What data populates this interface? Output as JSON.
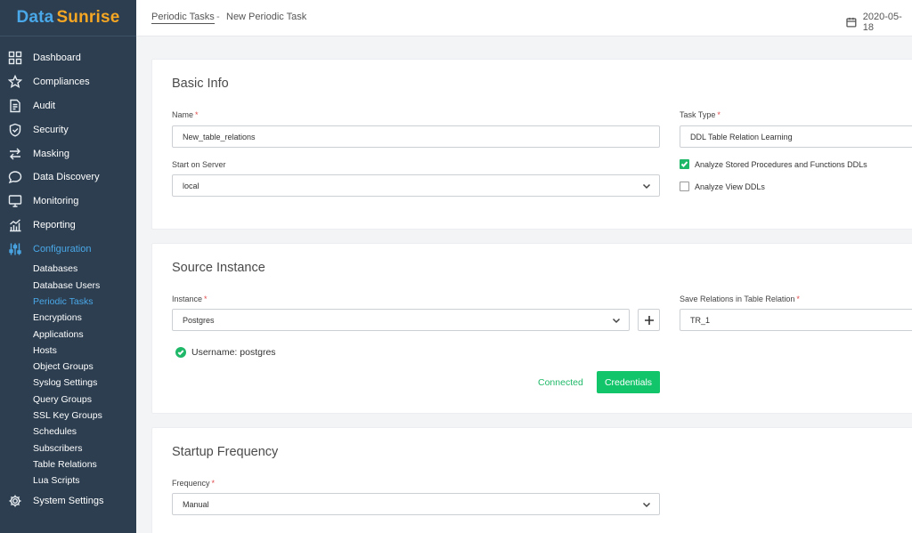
{
  "logo": {
    "part1": "Data",
    "part2": "Sunrise"
  },
  "nav": {
    "items": [
      {
        "label": "Dashboard",
        "icon": "dashboard-icon"
      },
      {
        "label": "Compliances",
        "icon": "star-icon"
      },
      {
        "label": "Audit",
        "icon": "audit-icon"
      },
      {
        "label": "Security",
        "icon": "shield-icon"
      },
      {
        "label": "Masking",
        "icon": "swap-arrows-icon"
      },
      {
        "label": "Data Discovery",
        "icon": "chat-bubble-icon"
      },
      {
        "label": "Monitoring",
        "icon": "monitor-icon"
      },
      {
        "label": "Reporting",
        "icon": "chart-icon"
      },
      {
        "label": "Configuration",
        "icon": "sliders-icon"
      }
    ],
    "sub_items": [
      "Databases",
      "Database Users",
      "Periodic Tasks",
      "Encryptions",
      "Applications",
      "Hosts",
      "Object Groups",
      "Syslog Settings",
      "Query Groups",
      "SSL Key Groups",
      "Schedules",
      "Subscribers",
      "Table Relations",
      "Lua Scripts"
    ],
    "system_settings": {
      "label": "System Settings",
      "icon": "gear-icon"
    }
  },
  "header": {
    "breadcrumb_link": "Periodic Tasks",
    "breadcrumb_sep": "-",
    "breadcrumb_current": "New Periodic Task",
    "date": "2020-05-18"
  },
  "basic_info": {
    "title": "Basic Info",
    "name_label": "Name",
    "name_value": "New_table_relations",
    "task_type_label": "Task Type",
    "task_type_value": "DDL Table Relation Learning",
    "server_label": "Start on Server",
    "server_value": "local",
    "check1_label": "Analyze Stored Procedures and Functions DDLs",
    "check1_checked": true,
    "check2_label": "Analyze View DDLs",
    "check2_checked": false,
    "required_mark": "*"
  },
  "source_instance": {
    "title": "Source Instance",
    "instance_label": "Instance",
    "instance_value": "Postgres",
    "save_label": "Save Relations in Table Relation",
    "save_value": "TR_1",
    "username_text": "Username: postgres",
    "connected_text": "Connected",
    "credentials_button": "Credentials"
  },
  "startup_frequency": {
    "title": "Startup Frequency",
    "frequency_label": "Frequency",
    "frequency_value": "Manual"
  },
  "colors": {
    "sidebar_bg": "#2c3e50",
    "accent_blue": "#4aa8e8",
    "accent_green": "#12c46a",
    "logo_orange": "#f5a623"
  }
}
